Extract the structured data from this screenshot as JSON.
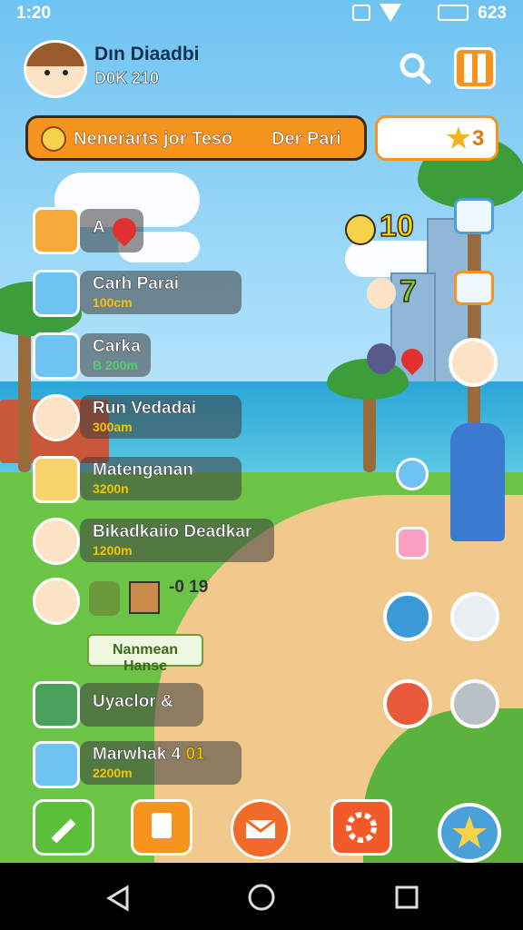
{
  "status": {
    "time": "1:20",
    "right": "623"
  },
  "player": {
    "name": "Dın Diaadbi",
    "sub": "D0K 210"
  },
  "banner": {
    "text": "Nenerarts jor Tesö",
    "right": "Der Pari"
  },
  "coins": {
    "value": "3"
  },
  "quests": [
    {
      "title": "A",
      "sub": ""
    },
    {
      "title": "Carh Parai",
      "sub": "100cm"
    },
    {
      "title": "Carka",
      "sub": "B 200m"
    },
    {
      "title": "Run Vedadai",
      "sub": "300am"
    },
    {
      "title": "Matenganan",
      "sub": "3200n"
    },
    {
      "title": "Bikadkaiio Deadkar",
      "sub": "1200m"
    },
    {
      "title": "-0 19",
      "sub": ""
    },
    {
      "title": "Nanmean Hanse",
      "sub": ""
    },
    {
      "title": "Uyaclor &",
      "sub": ""
    },
    {
      "title": "Marwhak 4",
      "sub": "2200m",
      "extra": "01"
    }
  ],
  "right_values": {
    "a": "10",
    "b": "7"
  },
  "colors": {
    "accent": "#f7941e",
    "sky": "#6fc3f2",
    "grass": "#6cc447"
  }
}
